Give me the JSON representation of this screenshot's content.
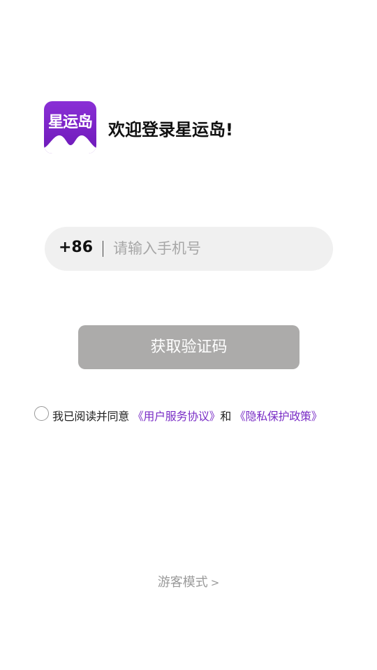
{
  "logo": {
    "text": "星运岛",
    "color": "#7a22c8"
  },
  "header": {
    "welcome": "欢迎登录星运岛!"
  },
  "phone": {
    "country_code": "+86",
    "placeholder": "请输入手机号",
    "value": ""
  },
  "actions": {
    "get_code_label": "获取验证码",
    "button_color": "#acabaa"
  },
  "agreement": {
    "checked": false,
    "prefix": "我已阅读并同意",
    "user_agreement": "《用户服务协议》",
    "conjunction": "和",
    "privacy_policy": "《隐私保护政策》",
    "link_color": "#7a2ec6"
  },
  "guest": {
    "label": "游客模式",
    "chevron": ">"
  }
}
